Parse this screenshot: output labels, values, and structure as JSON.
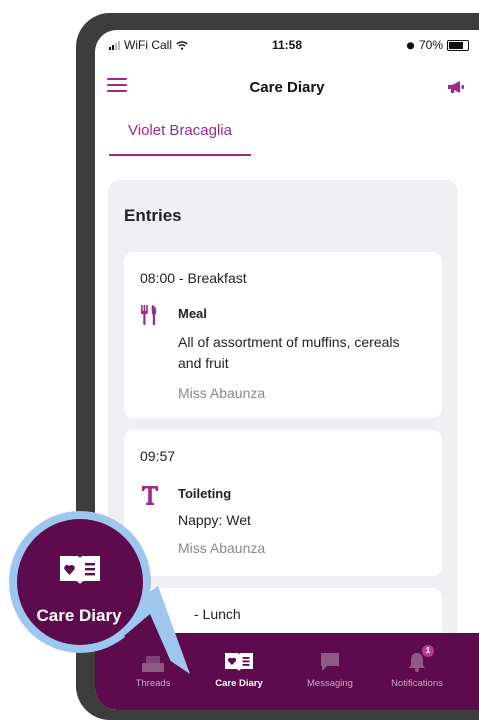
{
  "status_bar": {
    "carrier": "WiFi Call",
    "time": "11:58",
    "battery": "70%"
  },
  "header": {
    "title": "Care Diary"
  },
  "child_tab": {
    "name": "Violet Bracaglia"
  },
  "entries": {
    "heading": "Entries",
    "items": [
      {
        "time": "08:00 - Breakfast",
        "type": "Meal",
        "icon": "fork-knife-icon",
        "description": "All of assortment of muffins, cereals and fruit",
        "author": "Miss Abaunza"
      },
      {
        "time": "09:57",
        "type": "Toileting",
        "icon": "toilet-t-icon",
        "description": "Nappy: Wet",
        "author": "Miss Abaunza"
      },
      {
        "time": "- Lunch"
      }
    ]
  },
  "tabbar": {
    "tabs": [
      {
        "label": "Threads",
        "icon": "threads-icon"
      },
      {
        "label": "Care Diary",
        "icon": "care-diary-icon",
        "active": true
      },
      {
        "label": "Messaging",
        "icon": "chat-bubble-icon"
      },
      {
        "label": "Notifications",
        "icon": "bell-icon",
        "badge": "1"
      }
    ]
  },
  "callout": {
    "label": "Care Diary",
    "icon": "care-diary-icon"
  },
  "colors": {
    "brand": "#5d0b4d",
    "accent": "#9b2a89",
    "callout_ring": "#9ec7f0"
  }
}
